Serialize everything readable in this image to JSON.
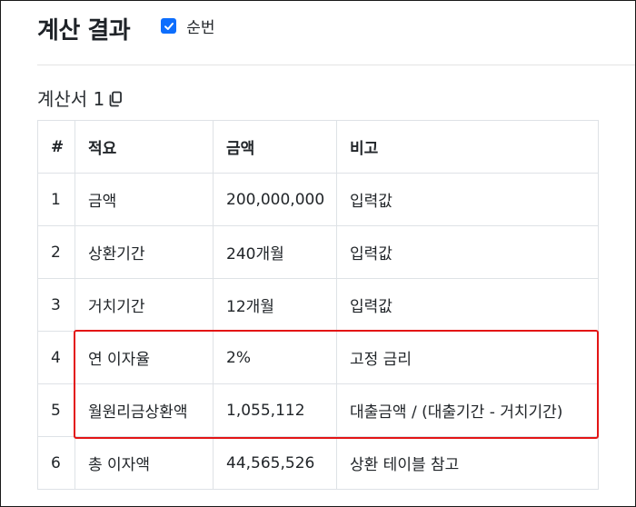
{
  "header": {
    "title": "계산 결과",
    "checkbox_label": "순번",
    "checkbox_checked": true
  },
  "section": {
    "title": "계산서 1",
    "copy_icon": "copy-icon"
  },
  "table": {
    "headers": [
      "#",
      "적요",
      "금액",
      "비고"
    ],
    "rows": [
      {
        "num": "1",
        "label": "금액",
        "amount": "200,000,000",
        "note": "입력값"
      },
      {
        "num": "2",
        "label": "상환기간",
        "amount": "240개월",
        "note": "입력값"
      },
      {
        "num": "3",
        "label": "거치기간",
        "amount": "12개월",
        "note": "입력값"
      },
      {
        "num": "4",
        "label": "연 이자율",
        "amount": "2%",
        "note": "고정 금리"
      },
      {
        "num": "5",
        "label": "월원리금상환액",
        "amount": "1,055,112",
        "note": "대출금액 / (대출기간 - 거치기간)"
      },
      {
        "num": "6",
        "label": "총 이자액",
        "amount": "44,565,526",
        "note": "상환 테이블 참고"
      }
    ]
  },
  "colors": {
    "accent": "#0d6efd",
    "highlight": "#e31515",
    "border": "#dee2e6"
  }
}
